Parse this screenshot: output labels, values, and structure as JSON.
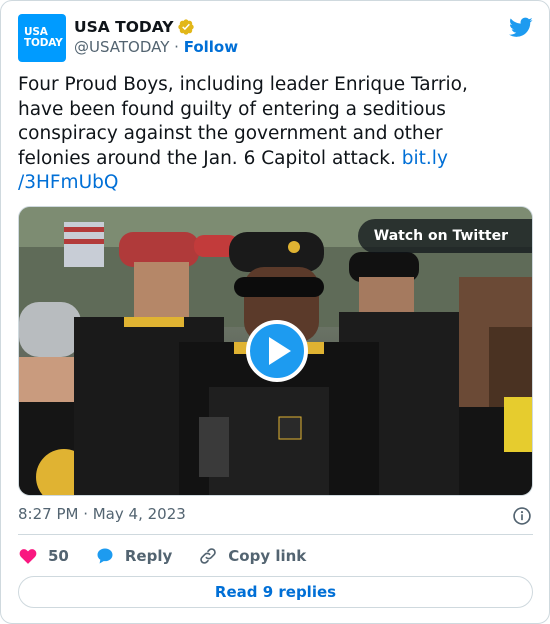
{
  "author": {
    "logo_text_line1": "USA",
    "logo_text_line2": "TODAY",
    "logo_color": "#009bff",
    "name": "USA TODAY",
    "handle": "@USATODAY",
    "separator": " · ",
    "follow_label": "Follow",
    "verified_icon": "gold-verified-badge"
  },
  "tweet": {
    "text": "Four Proud Boys, including leader Enrique Tarrio, have been found guilty of entering a seditious conspiracy against the government and other felonies around the Jan. 6 Capitol attack. ",
    "link_line1": "bit.ly",
    "link_line2": "/3HFmUbQ",
    "timestamp": "8:27 PM · May 4, 2023"
  },
  "media": {
    "watch_label": "Watch on Twitter",
    "play_color": "#1d9bf0"
  },
  "actions": {
    "like_count": "50",
    "reply_label": "Reply",
    "copy_label": "Copy link",
    "like_color": "#f91880",
    "reply_color": "#1d9bf0"
  },
  "footer": {
    "read_replies_label": "Read 9 replies"
  },
  "brand_color": "#1d9bf0"
}
